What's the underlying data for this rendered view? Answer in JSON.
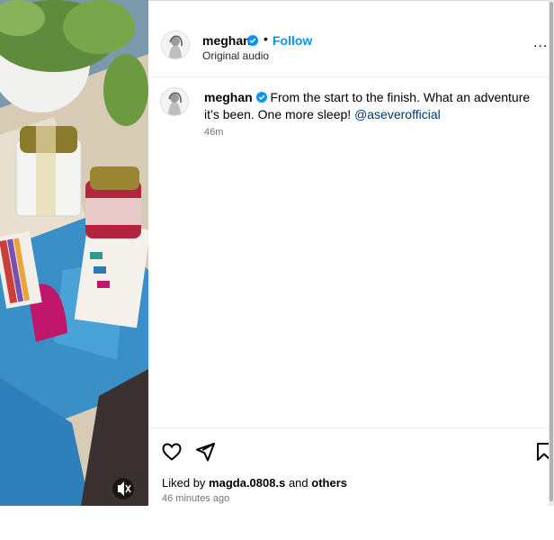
{
  "post": {
    "username": "meghan",
    "follow_label": "Follow",
    "separator": "•",
    "audio": "Original audio",
    "more_label": "...",
    "caption_text": "From the start to the finish. What an adventure it’s been. One more sleep!",
    "mention": "@aseverofficial",
    "caption_time": "46m",
    "liked_prefix": "Liked by",
    "liked_user": "magda.0808.s",
    "liked_and": "and",
    "liked_others": "others",
    "posted_ago": "46 minutes ago"
  },
  "icons": {
    "verified": "verified-badge-icon",
    "like": "heart-icon",
    "share": "paper-plane-icon",
    "save": "bookmark-icon",
    "mute": "muted-speaker-icon"
  },
  "colors": {
    "link_blue": "#0095f6",
    "mention_blue": "#00376b",
    "verified_blue": "#0095f6",
    "muted_gray": "#737373"
  }
}
